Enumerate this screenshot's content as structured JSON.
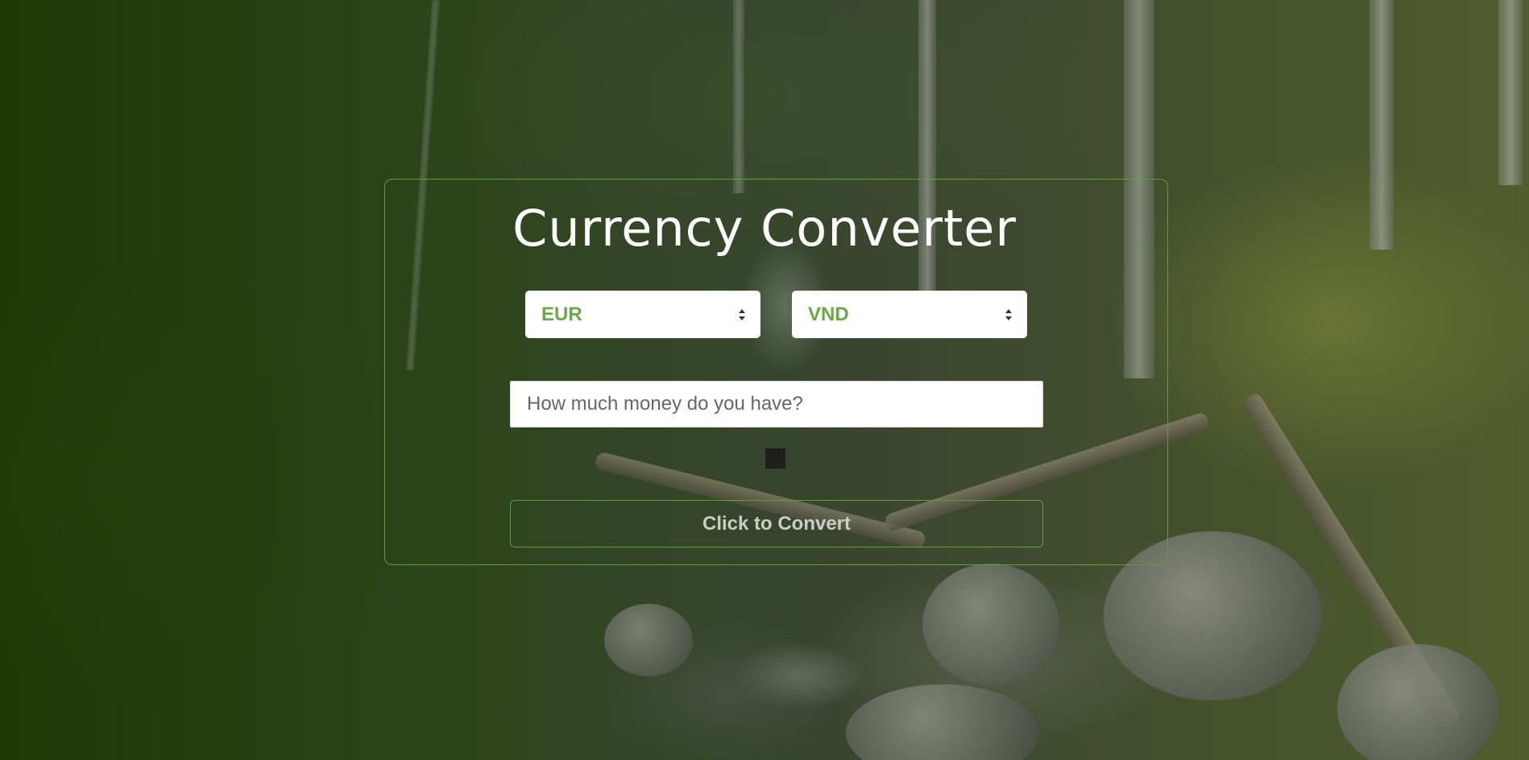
{
  "app": {
    "title": "Currency Converter"
  },
  "converter": {
    "from_currency": "EUR",
    "to_currency": "VND",
    "amount_value": "",
    "amount_placeholder": "How much money do you have?",
    "result_text": "",
    "convert_label": "Click to Convert"
  },
  "theme": {
    "accent": "#6aa94a",
    "border": "#5f9e3a",
    "title_color": "#ffffff"
  },
  "icons": {
    "select_arrows": "sort-arrows-icon"
  }
}
